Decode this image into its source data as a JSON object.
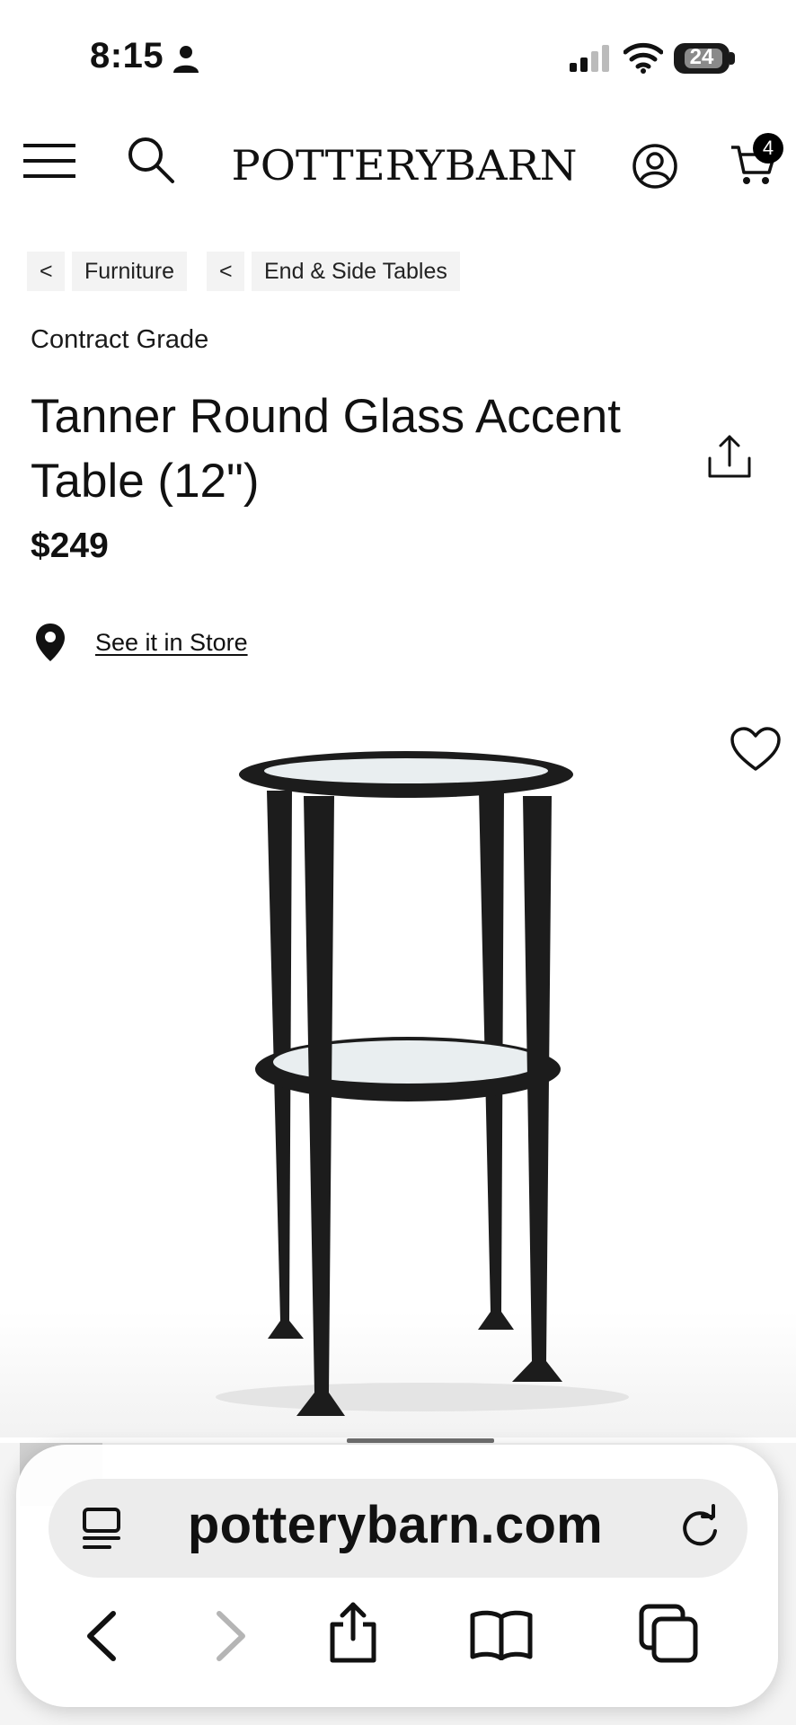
{
  "status_bar": {
    "time": "8:15",
    "battery": "24",
    "icons": [
      "person-icon",
      "signal-icon",
      "wifi-icon",
      "battery-icon"
    ]
  },
  "header": {
    "logo": "POTTERYBARN",
    "cart_count": "4",
    "icons": [
      "menu-icon",
      "search-icon",
      "account-icon",
      "cart-icon"
    ]
  },
  "breadcrumb": {
    "back_symbol": "<",
    "items": [
      "Furniture",
      "End & Side Tables"
    ]
  },
  "product": {
    "eyebrow": "Contract Grade",
    "title": "Tanner Round Glass Accent Table (12\")",
    "price": "$249",
    "store_link": "See it in Store",
    "image_count_indicator": "1"
  },
  "browser": {
    "url": "potterybarn.com",
    "icons": [
      "reader-icon",
      "reload-icon",
      "back-icon",
      "forward-icon",
      "share-icon",
      "bookmarks-icon",
      "tabs-icon"
    ]
  },
  "colors": {
    "text": "#111111",
    "chip_bg": "#f3f3f3",
    "table_metal": "#1c1c1c",
    "glass": "#e9eef0"
  }
}
